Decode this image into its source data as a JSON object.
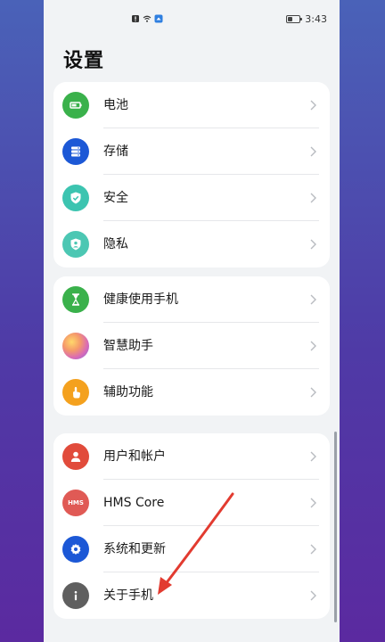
{
  "status_bar": {
    "time": "3:43",
    "icons_left": [
      "notification-alert-icon",
      "wifi-icon",
      "app-notification-icon"
    ],
    "battery_icon": "battery-icon"
  },
  "page": {
    "title": "设置"
  },
  "groups": [
    {
      "items": [
        {
          "label": "电池",
          "icon": "battery-setting-icon",
          "color": "#3ab14b"
        },
        {
          "label": "存储",
          "icon": "storage-icon",
          "color": "#1c58d6"
        },
        {
          "label": "安全",
          "icon": "shield-check-icon",
          "color": "#3cc4b0"
        },
        {
          "label": "隐私",
          "icon": "privacy-shield-icon",
          "color": "#4cc7b3"
        }
      ]
    },
    {
      "items": [
        {
          "label": "健康使用手机",
          "icon": "hourglass-icon",
          "color": "#3ab14b"
        },
        {
          "label": "智慧助手",
          "icon": "assistant-orb-icon",
          "color": "#e0728b"
        },
        {
          "label": "辅助功能",
          "icon": "hand-touch-icon",
          "color": "#f4a11e"
        }
      ]
    },
    {
      "items": [
        {
          "label": "用户和帐户",
          "icon": "user-icon",
          "color": "#e14b3b"
        },
        {
          "label": "HMS Core",
          "icon": "hms-icon",
          "icon_text": "HMS",
          "color": "#e05a55"
        },
        {
          "label": "系统和更新",
          "icon": "system-gear-icon",
          "color": "#1c58d6"
        },
        {
          "label": "关于手机",
          "icon": "info-icon",
          "color": "#5f5f5f"
        }
      ]
    }
  ],
  "annotation": {
    "arrow_color": "#e23b30"
  }
}
